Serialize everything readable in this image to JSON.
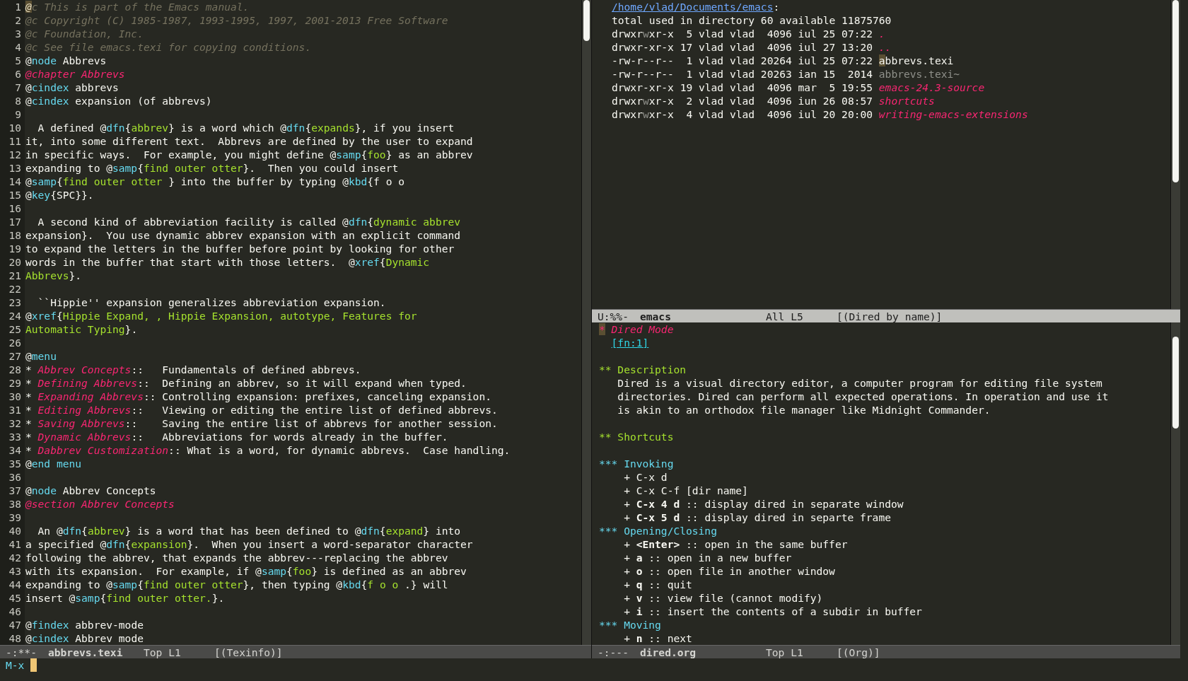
{
  "left_window": {
    "lines": [
      {
        "number": "1",
        "segments": [
          {
            "kind": "cursor",
            "text": "@"
          },
          {
            "kind": "comment",
            "text": "c This is part of the Emacs manual."
          }
        ]
      },
      {
        "number": "2",
        "segments": [
          {
            "kind": "comment",
            "text": "@c Copyright (C) 1985-1987, 1993-1995, 1997, 2001-2013 Free Software"
          }
        ]
      },
      {
        "number": "3",
        "segments": [
          {
            "kind": "comment",
            "text": "@c Foundation, Inc."
          }
        ]
      },
      {
        "number": "4",
        "segments": [
          {
            "kind": "comment",
            "text": "@c See file emacs.texi for copying conditions."
          }
        ]
      },
      {
        "number": "5",
        "segments": [
          {
            "kind": "plain",
            "text": "@"
          },
          {
            "kind": "keyword",
            "text": "node"
          },
          {
            "kind": "plain",
            "text": " Abbrevs"
          }
        ]
      },
      {
        "number": "6",
        "segments": [
          {
            "kind": "heading",
            "text": "@chapter Abbrevs"
          }
        ]
      },
      {
        "number": "7",
        "segments": [
          {
            "kind": "plain",
            "text": "@"
          },
          {
            "kind": "keyword",
            "text": "cindex"
          },
          {
            "kind": "plain",
            "text": " abbrevs"
          }
        ]
      },
      {
        "number": "8",
        "segments": [
          {
            "kind": "plain",
            "text": "@"
          },
          {
            "kind": "keyword",
            "text": "cindex"
          },
          {
            "kind": "plain",
            "text": " expansion (of abbrevs)"
          }
        ]
      },
      {
        "number": "9"
      },
      {
        "number": "10",
        "segments": [
          {
            "kind": "plain",
            "text": "  A defined @"
          },
          {
            "kind": "keyword",
            "text": "dfn"
          },
          {
            "kind": "plain",
            "text": "{"
          },
          {
            "kind": "argument",
            "text": "abbrev"
          },
          {
            "kind": "plain",
            "text": "} is a word which @"
          },
          {
            "kind": "keyword",
            "text": "dfn"
          },
          {
            "kind": "plain",
            "text": "{"
          },
          {
            "kind": "argument",
            "text": "expands"
          },
          {
            "kind": "plain",
            "text": "}, if you insert"
          }
        ]
      },
      {
        "number": "11",
        "segments": [
          {
            "kind": "plain",
            "text": "it, into some different text.  Abbrevs are defined by the user to expand"
          }
        ]
      },
      {
        "number": "12",
        "segments": [
          {
            "kind": "plain",
            "text": "in specific ways.  For example, you might define @"
          },
          {
            "kind": "keyword",
            "text": "samp"
          },
          {
            "kind": "plain",
            "text": "{"
          },
          {
            "kind": "argument",
            "text": "foo"
          },
          {
            "kind": "plain",
            "text": "} as an abbrev"
          }
        ]
      },
      {
        "number": "13",
        "segments": [
          {
            "kind": "plain",
            "text": "expanding to @"
          },
          {
            "kind": "keyword",
            "text": "samp"
          },
          {
            "kind": "plain",
            "text": "{"
          },
          {
            "kind": "argument",
            "text": "find outer otter"
          },
          {
            "kind": "plain",
            "text": "}.  Then you could insert"
          }
        ]
      },
      {
        "number": "14",
        "segments": [
          {
            "kind": "plain",
            "text": "@"
          },
          {
            "kind": "keyword",
            "text": "samp"
          },
          {
            "kind": "plain",
            "text": "{"
          },
          {
            "kind": "argument",
            "text": "find outer otter "
          },
          {
            "kind": "plain",
            "text": "} into the buffer by typing @"
          },
          {
            "kind": "keyword",
            "text": "kbd"
          },
          {
            "kind": "plain",
            "text": "{f o o"
          }
        ]
      },
      {
        "number": "15",
        "segments": [
          {
            "kind": "plain",
            "text": "@"
          },
          {
            "kind": "keyword",
            "text": "key"
          },
          {
            "kind": "plain",
            "text": "{SPC}}."
          }
        ]
      },
      {
        "number": "16"
      },
      {
        "number": "17",
        "segments": [
          {
            "kind": "plain",
            "text": "  A second kind of abbreviation facility is called @"
          },
          {
            "kind": "keyword",
            "text": "dfn"
          },
          {
            "kind": "plain",
            "text": "{"
          },
          {
            "kind": "argument",
            "text": "dynamic abbrev"
          }
        ]
      },
      {
        "number": "18",
        "segments": [
          {
            "kind": "plain",
            "text": "expansion}.  You use dynamic abbrev expansion with an explicit command"
          }
        ]
      },
      {
        "number": "19",
        "segments": [
          {
            "kind": "plain",
            "text": "to expand the letters in the buffer before point by looking for other"
          }
        ]
      },
      {
        "number": "20",
        "segments": [
          {
            "kind": "plain",
            "text": "words in the buffer that start with those letters.  @"
          },
          {
            "kind": "keyword",
            "text": "xref"
          },
          {
            "kind": "plain",
            "text": "{"
          },
          {
            "kind": "argument",
            "text": "Dynamic"
          }
        ]
      },
      {
        "number": "21",
        "segments": [
          {
            "kind": "argument",
            "text": "Abbrevs"
          },
          {
            "kind": "plain",
            "text": "}."
          }
        ]
      },
      {
        "number": "22"
      },
      {
        "number": "23",
        "segments": [
          {
            "kind": "plain",
            "text": "  ``Hippie'' expansion generalizes abbreviation expansion."
          }
        ]
      },
      {
        "number": "24",
        "segments": [
          {
            "kind": "plain",
            "text": "@"
          },
          {
            "kind": "keyword",
            "text": "xref"
          },
          {
            "kind": "plain",
            "text": "{"
          },
          {
            "kind": "argument",
            "text": "Hippie Expand, , Hippie Expansion, autotype, Features for"
          }
        ]
      },
      {
        "number": "25",
        "segments": [
          {
            "kind": "argument",
            "text": "Automatic Typing"
          },
          {
            "kind": "plain",
            "text": "}."
          }
        ]
      },
      {
        "number": "26"
      },
      {
        "number": "27",
        "segments": [
          {
            "kind": "plain",
            "text": "@"
          },
          {
            "kind": "keyword",
            "text": "menu"
          }
        ]
      },
      {
        "number": "28",
        "segments": [
          {
            "kind": "plain",
            "text": "* "
          },
          {
            "kind": "heading",
            "text": "Abbrev Concepts"
          },
          {
            "kind": "plain",
            "text": "::   Fundamentals of defined abbrevs."
          }
        ]
      },
      {
        "number": "29",
        "segments": [
          {
            "kind": "plain",
            "text": "* "
          },
          {
            "kind": "heading",
            "text": "Defining Abbrevs"
          },
          {
            "kind": "plain",
            "text": "::  Defining an abbrev, so it will expand when typed."
          }
        ]
      },
      {
        "number": "30",
        "segments": [
          {
            "kind": "plain",
            "text": "* "
          },
          {
            "kind": "heading",
            "text": "Expanding Abbrevs"
          },
          {
            "kind": "plain",
            "text": ":: Controlling expansion: prefixes, canceling expansion."
          }
        ]
      },
      {
        "number": "31",
        "segments": [
          {
            "kind": "plain",
            "text": "* "
          },
          {
            "kind": "heading",
            "text": "Editing Abbrevs"
          },
          {
            "kind": "plain",
            "text": "::   Viewing or editing the entire list of defined abbrevs."
          }
        ]
      },
      {
        "number": "32",
        "segments": [
          {
            "kind": "plain",
            "text": "* "
          },
          {
            "kind": "heading",
            "text": "Saving Abbrevs"
          },
          {
            "kind": "plain",
            "text": "::    Saving the entire list of abbrevs for another session."
          }
        ]
      },
      {
        "number": "33",
        "segments": [
          {
            "kind": "plain",
            "text": "* "
          },
          {
            "kind": "heading",
            "text": "Dynamic Abbrevs"
          },
          {
            "kind": "plain",
            "text": "::   Abbreviations for words already in the buffer."
          }
        ]
      },
      {
        "number": "34",
        "segments": [
          {
            "kind": "plain",
            "text": "* "
          },
          {
            "kind": "heading",
            "text": "Dabbrev Customization"
          },
          {
            "kind": "plain",
            "text": ":: What is a word, for dynamic abbrevs.  Case handling."
          }
        ]
      },
      {
        "number": "35",
        "segments": [
          {
            "kind": "plain",
            "text": "@"
          },
          {
            "kind": "keyword",
            "text": "end menu"
          }
        ]
      },
      {
        "number": "36"
      },
      {
        "number": "37",
        "segments": [
          {
            "kind": "plain",
            "text": "@"
          },
          {
            "kind": "keyword",
            "text": "node"
          },
          {
            "kind": "plain",
            "text": " Abbrev Concepts"
          }
        ]
      },
      {
        "number": "38",
        "segments": [
          {
            "kind": "heading",
            "text": "@section Abbrev Concepts"
          }
        ]
      },
      {
        "number": "39"
      },
      {
        "number": "40",
        "segments": [
          {
            "kind": "plain",
            "text": "  An @"
          },
          {
            "kind": "keyword",
            "text": "dfn"
          },
          {
            "kind": "plain",
            "text": "{"
          },
          {
            "kind": "argument",
            "text": "abbrev"
          },
          {
            "kind": "plain",
            "text": "} is a word that has been defined to @"
          },
          {
            "kind": "keyword",
            "text": "dfn"
          },
          {
            "kind": "plain",
            "text": "{"
          },
          {
            "kind": "argument",
            "text": "expand"
          },
          {
            "kind": "plain",
            "text": "} into"
          }
        ]
      },
      {
        "number": "41",
        "segments": [
          {
            "kind": "plain",
            "text": "a specified @"
          },
          {
            "kind": "keyword",
            "text": "dfn"
          },
          {
            "kind": "plain",
            "text": "{"
          },
          {
            "kind": "argument",
            "text": "expansion"
          },
          {
            "kind": "plain",
            "text": "}.  When you insert a word-separator character"
          }
        ]
      },
      {
        "number": "42",
        "segments": [
          {
            "kind": "plain",
            "text": "following the abbrev, that expands the abbrev---replacing the abbrev"
          }
        ]
      },
      {
        "number": "43",
        "segments": [
          {
            "kind": "plain",
            "text": "with its expansion.  For example, if @"
          },
          {
            "kind": "keyword",
            "text": "samp"
          },
          {
            "kind": "plain",
            "text": "{"
          },
          {
            "kind": "argument",
            "text": "foo"
          },
          {
            "kind": "plain",
            "text": "} is defined as an abbrev"
          }
        ]
      },
      {
        "number": "44",
        "segments": [
          {
            "kind": "plain",
            "text": "expanding to @"
          },
          {
            "kind": "keyword",
            "text": "samp"
          },
          {
            "kind": "plain",
            "text": "{"
          },
          {
            "kind": "argument",
            "text": "find outer otter"
          },
          {
            "kind": "plain",
            "text": "}, then typing @"
          },
          {
            "kind": "keyword",
            "text": "kbd"
          },
          {
            "kind": "plain",
            "text": "{"
          },
          {
            "kind": "argument",
            "text": "f o o"
          },
          {
            "kind": "plain",
            "text": " .} will"
          }
        ]
      },
      {
        "number": "45",
        "segments": [
          {
            "kind": "plain",
            "text": "insert @"
          },
          {
            "kind": "keyword",
            "text": "samp"
          },
          {
            "kind": "plain",
            "text": "{"
          },
          {
            "kind": "argument",
            "text": "find outer otter."
          },
          {
            "kind": "plain",
            "text": "}."
          }
        ]
      },
      {
        "number": "46"
      },
      {
        "number": "47",
        "segments": [
          {
            "kind": "plain",
            "text": "@"
          },
          {
            "kind": "keyword",
            "text": "findex"
          },
          {
            "kind": "plain",
            "text": " abbrev-mode"
          }
        ]
      },
      {
        "number": "48",
        "segments": [
          {
            "kind": "plain",
            "text": "@"
          },
          {
            "kind": "keyword",
            "text": "cindex"
          },
          {
            "kind": "plain",
            "text": " Abbrev mode"
          }
        ]
      }
    ],
    "mode_line": {
      "status": "-:**-",
      "buffer": "abbrevs.texi",
      "position": "Top L1",
      "mode": "[(Texinfo)]",
      "active": false
    }
  },
  "dired_window": {
    "path": "/home/vlad/Documents/emacs",
    "path_suffix": ":",
    "lines": [
      {
        "segments": [
          {
            "kind": "plain",
            "text": "total used in directory 60 available 11875760"
          }
        ]
      },
      {
        "segments": [
          {
            "kind": "plain",
            "text": "drwxr"
          },
          {
            "kind": "dim",
            "text": "w"
          },
          {
            "kind": "plain",
            "text": "xr-x  5 vlad vlad  4096 iul 25 07:22 "
          },
          {
            "kind": "directory",
            "text": "."
          }
        ]
      },
      {
        "segments": [
          {
            "kind": "plain",
            "text": "drwxr-xr-x 17 vlad vlad  4096 iul 27 13:20 "
          },
          {
            "kind": "directory",
            "text": ".."
          }
        ]
      },
      {
        "segments": [
          {
            "kind": "plain",
            "text": "-rw-r--r--  1 vlad vlad 20264 iul 25 07:22 "
          },
          {
            "kind": "cursor",
            "text": "a"
          },
          {
            "kind": "plain",
            "text": "bbrevs.texi"
          }
        ]
      },
      {
        "segments": [
          {
            "kind": "plain",
            "text": "-rw-r--r--  1 vlad vlad 20263 ian 15  2014 "
          },
          {
            "kind": "dim",
            "text": "abbrevs.texi~"
          }
        ]
      },
      {
        "segments": [
          {
            "kind": "plain",
            "text": "drwxr-xr-x 19 vlad vlad  4096 mar  5 19:55 "
          },
          {
            "kind": "directory",
            "text": "emacs-24.3-source"
          }
        ]
      },
      {
        "segments": [
          {
            "kind": "plain",
            "text": "drwxr"
          },
          {
            "kind": "dim",
            "text": "w"
          },
          {
            "kind": "plain",
            "text": "xr-x  2 vlad vlad  4096 iun 26 08:57 "
          },
          {
            "kind": "directory",
            "text": "shortcuts"
          }
        ]
      },
      {
        "segments": [
          {
            "kind": "plain",
            "text": "drwxr"
          },
          {
            "kind": "dim",
            "text": "w"
          },
          {
            "kind": "plain",
            "text": "xr-x  4 vlad vlad  4096 iul 20 20:00 "
          },
          {
            "kind": "directory",
            "text": "writing-emacs-extensions"
          }
        ]
      }
    ],
    "mode_line": {
      "status": "U:%%-",
      "buffer": "emacs",
      "position": "All L5",
      "mode": "[(Dired by name)]",
      "active": true
    }
  },
  "org_window": {
    "lines": [
      {
        "kind": "heading1",
        "bullet": "*",
        "text": " Dired Mode"
      },
      {
        "kind": "footnote",
        "text": "[fn:1]"
      },
      {
        "kind": "blank"
      },
      {
        "kind": "heading2",
        "text": "** Description"
      },
      {
        "kind": "body",
        "text": "Dired is a visual directory editor, a computer program for editing file system"
      },
      {
        "kind": "body",
        "text": "directories. Dired can perform all expected operations. In operation and use it"
      },
      {
        "kind": "body",
        "text": "is akin to an orthodox file manager like Midnight Commander."
      },
      {
        "kind": "blank"
      },
      {
        "kind": "heading2",
        "text": "** Shortcuts"
      },
      {
        "kind": "blank"
      },
      {
        "kind": "heading3",
        "text": "*** Invoking"
      },
      {
        "kind": "item",
        "bullet": "+",
        "text": "C-x d"
      },
      {
        "kind": "item",
        "bullet": "+",
        "text": "C-x C-f [dir name]"
      },
      {
        "kind": "item",
        "bullet": "+",
        "key": "C-x 4 d",
        "text": " :: display dired in separate window"
      },
      {
        "kind": "item",
        "bullet": "+",
        "key": "C-x 5 d",
        "text": " :: display dired in separte frame"
      },
      {
        "kind": "heading3",
        "text": "*** Opening/Closing"
      },
      {
        "kind": "item",
        "bullet": "+",
        "key": "<Enter>",
        "text": " :: open in the same buffer"
      },
      {
        "kind": "item",
        "bullet": "+",
        "key": "a",
        "text": " :: open in a new buffer"
      },
      {
        "kind": "item",
        "bullet": "+",
        "key": "o",
        "text": " :: open file in another window"
      },
      {
        "kind": "item",
        "bullet": "+",
        "key": "q",
        "text": " :: quit"
      },
      {
        "kind": "item",
        "bullet": "+",
        "key": "v",
        "text": " :: view file (cannot modify)"
      },
      {
        "kind": "item",
        "bullet": "+",
        "key": "i",
        "text": " :: insert the contents of a subdir in buffer"
      },
      {
        "kind": "heading3",
        "text": "*** Moving"
      },
      {
        "kind": "item",
        "bullet": "+",
        "key": "n",
        "text": " :: next"
      }
    ],
    "mode_line": {
      "status": "-:---",
      "buffer": "dired.org",
      "position": "Top L1",
      "mode": "[(Org)]",
      "active": false
    }
  },
  "minibuffer": {
    "prompt": "M-x"
  }
}
